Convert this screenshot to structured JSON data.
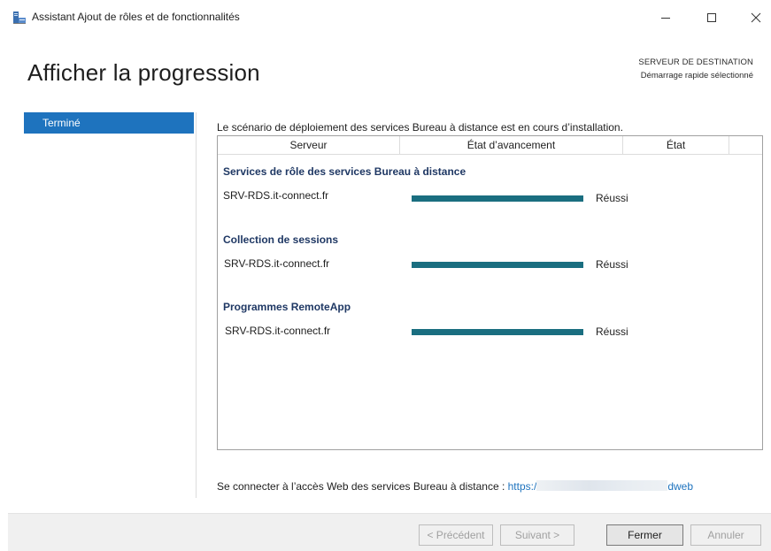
{
  "window": {
    "title": "Assistant Ajout de rôles et de fonctionnalités",
    "icon": "server-manager-icon",
    "controls": [
      "minimize-icon",
      "maximize-icon",
      "close-icon"
    ]
  },
  "header": {
    "title": "Afficher la progression",
    "destination_label": "SERVEUR DE DESTINATION",
    "destination_value": "Démarrage rapide sélectionné"
  },
  "nav": {
    "items": [
      {
        "label": "Terminé",
        "selected": true
      }
    ]
  },
  "main": {
    "scenario_text": "Le scénario de déploiement des services Bureau à distance est en cours d’installation.",
    "columns": [
      "Serveur",
      "État d’avancement",
      "État"
    ],
    "groups": [
      {
        "title": "Services de rôle des services Bureau à distance",
        "server": "SRV-RDS.it-connect.fr",
        "progress": 1.0,
        "status": "Réussi"
      },
      {
        "title": "Collection de sessions",
        "server": "SRV-RDS.it-connect.fr",
        "progress": 1.0,
        "status": "Réussi"
      },
      {
        "title": "Programmes RemoteApp",
        "server": "SRV-RDS.it-connect.fr",
        "progress": 1.0,
        "status": "Réussi"
      }
    ],
    "web_access_text": "Se connecter à l’accès Web des services Bureau à distance : ",
    "web_link_start": "https:/",
    "web_link_end": "dweb"
  },
  "footer": {
    "prev_label": "< Précédent",
    "next_label": "Suivant >",
    "close_label": "Fermer",
    "cancel_label": "Annuler"
  },
  "colors": {
    "accent": "#1e73be",
    "progress": "#1a6e80",
    "group_title": "#1f3864"
  }
}
